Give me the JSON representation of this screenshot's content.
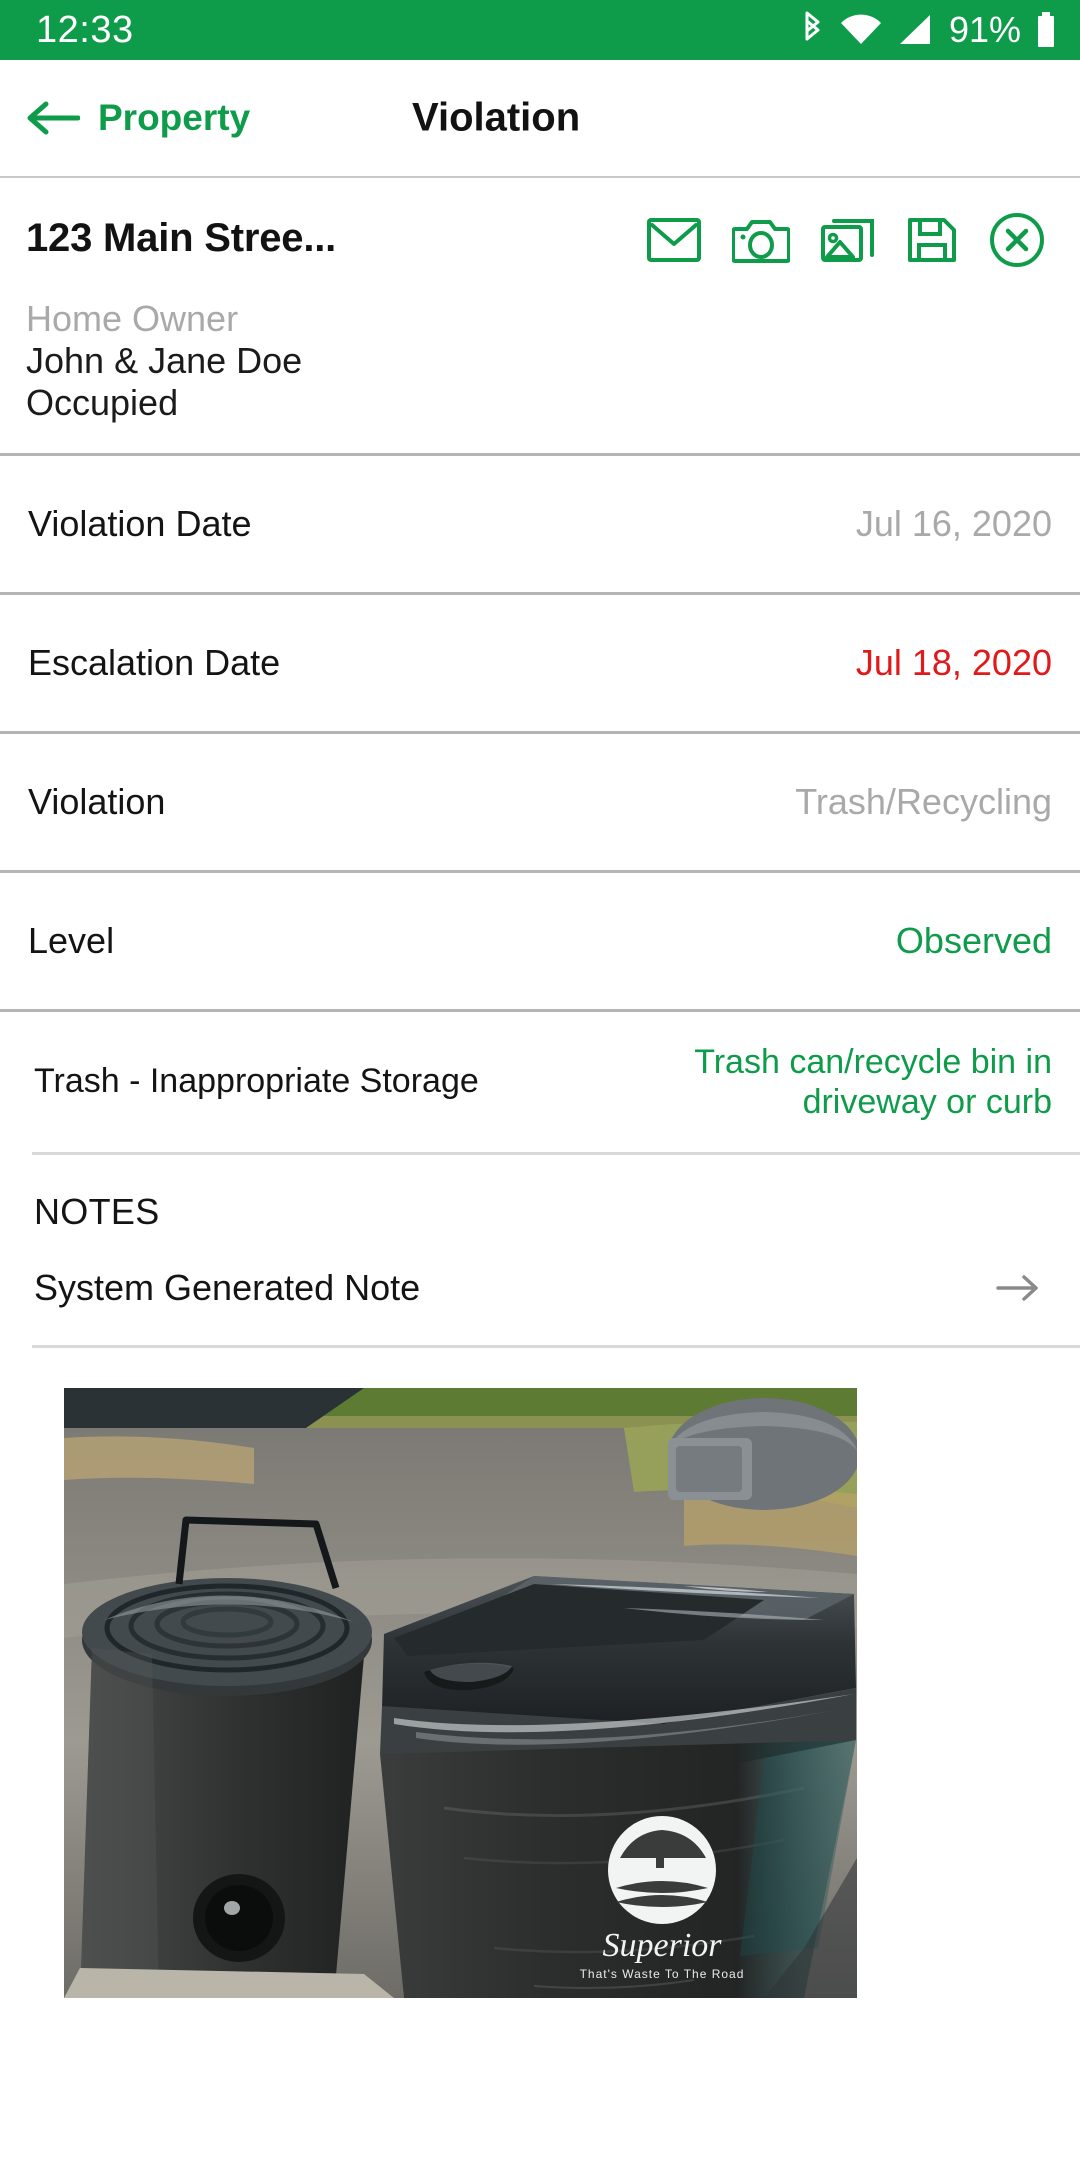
{
  "status_bar": {
    "time": "12:33",
    "battery_percent": "91%",
    "icons": [
      "bluetooth-icon",
      "wifi-icon",
      "cellular-signal-icon",
      "battery-icon"
    ],
    "background_color": "#0e9c4b"
  },
  "app_bar": {
    "back_label": "Property",
    "back_icon": "back-arrow-icon",
    "title": "Violation",
    "accent_color": "#0e9c4b"
  },
  "property": {
    "address": "123 Main Stree...",
    "owner_label": "Home Owner",
    "owner_name": "John & Jane Doe",
    "occupancy": "Occupied",
    "actions": [
      {
        "name": "email-icon",
        "label": "Email"
      },
      {
        "name": "camera-icon",
        "label": "Camera"
      },
      {
        "name": "gallery-icon",
        "label": "Gallery"
      },
      {
        "name": "save-icon",
        "label": "Save"
      },
      {
        "name": "close-icon",
        "label": "Close"
      }
    ]
  },
  "detail_rows": [
    {
      "label": "Violation Date",
      "value": "Jul 16, 2020",
      "value_style": "muted"
    },
    {
      "label": "Escalation Date",
      "value": "Jul 18, 2020",
      "value_style": "red"
    },
    {
      "label": "Violation",
      "value": "Trash/Recycling",
      "value_style": "muted"
    },
    {
      "label": "Level",
      "value": "Observed",
      "value_style": "green"
    }
  ],
  "rule_row": {
    "label": "Trash - Inappropriate Storage",
    "value": "Trash can/recycle bin in driveway or curb"
  },
  "notes": {
    "title": "NOTES",
    "items": [
      {
        "text": "System Generated Note",
        "chevron": "arrow-right-icon"
      }
    ]
  },
  "photo": {
    "alt": "Trash cans and recycle bin at curb",
    "caption": ""
  },
  "colors": {
    "brand_green": "#0e9c4b",
    "alert_red": "#e0191b",
    "muted_gray": "#a9a9a9",
    "divider": "#b5b5b5"
  }
}
